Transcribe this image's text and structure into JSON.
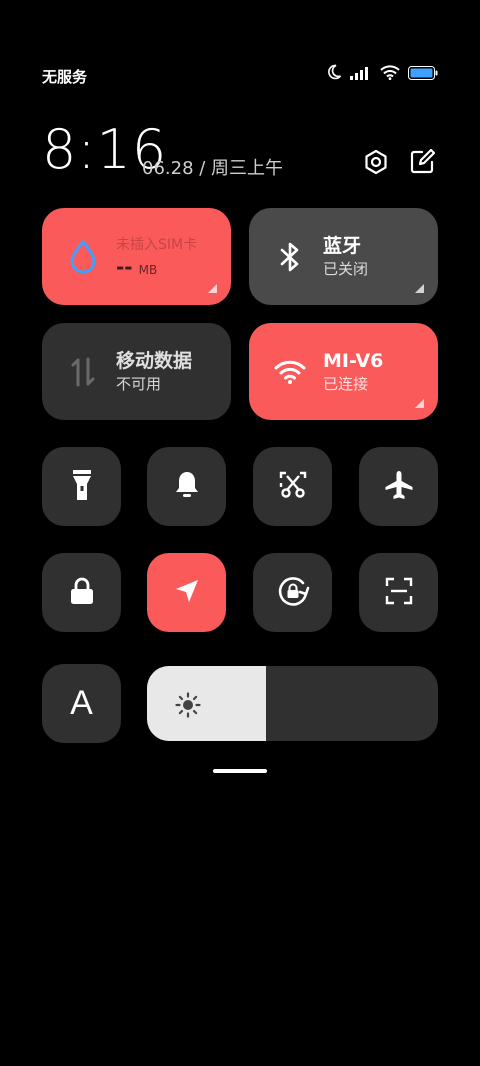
{
  "status_bar": {
    "carrier": "无服务",
    "icons": [
      "moon-icon",
      "signal-icon",
      "wifi-icon",
      "battery-icon"
    ]
  },
  "header": {
    "time": "8:16",
    "date": "06.28 / 周三上午",
    "buttons": [
      "settings-icon",
      "edit-icon"
    ]
  },
  "tiles": {
    "sim": {
      "title": "未插入SIM卡",
      "value": "--",
      "unit": "MB",
      "active": true
    },
    "bluetooth": {
      "title": "蓝牙",
      "status": "已关闭",
      "active": false
    },
    "mobile_data": {
      "title": "移动数据",
      "status": "不可用",
      "active": false
    },
    "wifi": {
      "title": "MI-V6",
      "status": "已连接",
      "active": true
    }
  },
  "toggles": [
    {
      "name": "flashlight",
      "icon": "flashlight-icon",
      "active": false
    },
    {
      "name": "bell",
      "icon": "bell-icon",
      "active": false
    },
    {
      "name": "screenshot",
      "icon": "scissors-screenshot-icon",
      "active": false
    },
    {
      "name": "airplane",
      "icon": "airplane-icon",
      "active": false
    },
    {
      "name": "lock",
      "icon": "lock-icon",
      "active": false
    },
    {
      "name": "location",
      "icon": "location-arrow-icon",
      "active": true
    },
    {
      "name": "rotation-lock",
      "icon": "rotation-lock-icon",
      "active": false
    },
    {
      "name": "scanner",
      "icon": "scan-icon",
      "active": false
    }
  ],
  "font_button": {
    "label": "A"
  },
  "brightness": {
    "level": 0.41,
    "icon": "sun-icon"
  },
  "colors": {
    "accent": "#fa5a5a",
    "tile_dark": "#303030",
    "tile_grey": "#4a4a4a",
    "background": "#000000"
  }
}
